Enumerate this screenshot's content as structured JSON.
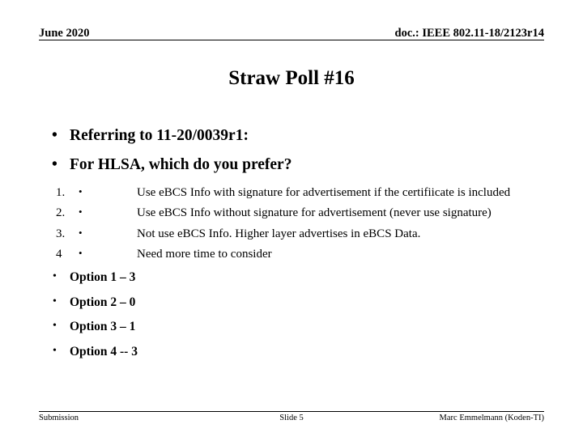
{
  "header": {
    "left": "June 2020",
    "right": "doc.: IEEE 802.11-18/2123r14"
  },
  "title": "Straw Poll #16",
  "bullet_glyph": "•",
  "content": {
    "level1": [
      {
        "text": "Referring to 11-20/0039r1:"
      },
      {
        "text": "For HLSA, which do you prefer?"
      }
    ],
    "options": [
      {
        "number": "1.",
        "text": "Use eBCS Info with signature for advertisement if the certifiicate is included"
      },
      {
        "number": "2.",
        "text": "Use eBCS Info without signature for advertisement (never use signature)"
      },
      {
        "number": "3.",
        "text": "Not use eBCS Info. Higher layer advertises in eBCS Data."
      },
      {
        "number": "4",
        "text": "Need more time to consider"
      }
    ],
    "results": [
      {
        "text": "Option 1 –  3"
      },
      {
        "text": "Option 2 – 0"
      },
      {
        "text": "Option 3 – 1"
      },
      {
        "text": "Option 4 -- 3"
      }
    ]
  },
  "footer": {
    "left": "Submission",
    "center": "Slide 5",
    "right": "Marc Emmelmann (Koden-TI)"
  }
}
